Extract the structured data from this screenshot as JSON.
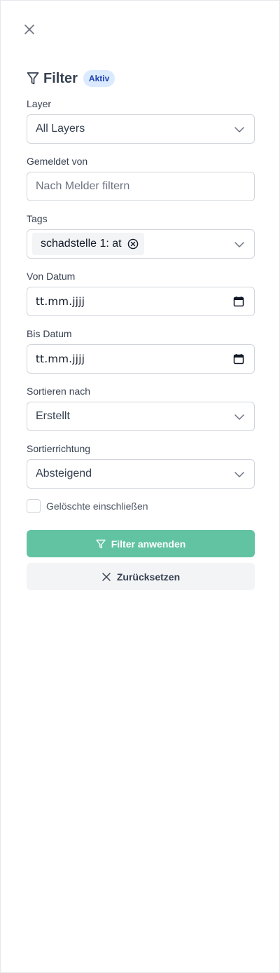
{
  "header": {
    "title": "Filter",
    "badge": "Aktiv",
    "close_icon": "close-icon",
    "filter_icon": "funnel-icon"
  },
  "fields": {
    "layer": {
      "label": "Layer",
      "value": "All Layers"
    },
    "reporter": {
      "label": "Gemeldet von",
      "placeholder": "Nach Melder filtern",
      "value": ""
    },
    "tags": {
      "label": "Tags",
      "selected": [
        "schadstelle 1: at"
      ]
    },
    "from_date": {
      "label": "Von Datum",
      "value": "tt.mm.jjjj"
    },
    "to_date": {
      "label": "Bis Datum",
      "value": "tt.mm.jjjj"
    },
    "sort_by": {
      "label": "Sortieren nach",
      "value": "Erstellt"
    },
    "sort_direction": {
      "label": "Sortierrichtung",
      "value": "Absteigend"
    }
  },
  "include_deleted": {
    "label": "Gelöschte einschließen",
    "checked": false
  },
  "actions": {
    "apply_label": "Filter anwenden",
    "reset_label": "Zurücksetzen"
  },
  "colors": {
    "accent": "#62c3a2",
    "badge_bg": "#dbeafe",
    "badge_text": "#1e40af"
  }
}
